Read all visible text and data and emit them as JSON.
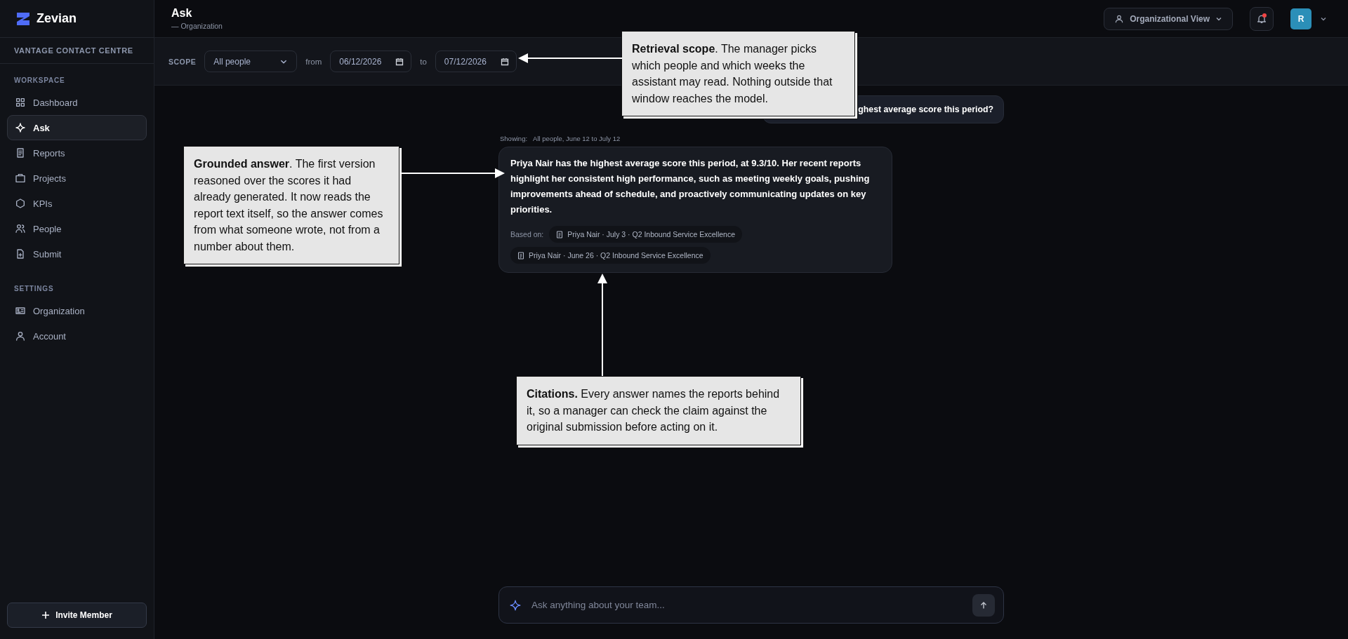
{
  "brand": {
    "name": "Zevian"
  },
  "sidebar": {
    "org": "VANTAGE CONTACT CENTRE",
    "sections": [
      {
        "title": "WORKSPACE",
        "items": [
          {
            "label": "Dashboard",
            "selected": false
          },
          {
            "label": "Ask",
            "selected": true
          },
          {
            "label": "Reports",
            "selected": false
          },
          {
            "label": "Projects",
            "selected": false
          },
          {
            "label": "KPIs",
            "selected": false
          },
          {
            "label": "People",
            "selected": false
          },
          {
            "label": "Submit",
            "selected": false
          }
        ]
      },
      {
        "title": "SETTINGS",
        "items": [
          {
            "label": "Organization",
            "selected": false
          },
          {
            "label": "Account",
            "selected": false
          }
        ]
      }
    ],
    "invite_button": "Invite Member"
  },
  "header": {
    "title": "Ask",
    "subtitle": "— Organization",
    "view_button": "Organizational View",
    "unread": true,
    "avatar": "R"
  },
  "scope": {
    "label": "SCOPE",
    "people": "All people",
    "from_label": "from",
    "from": "06/12/2026",
    "to_label": "to",
    "to": "07/12/2026"
  },
  "chat": {
    "question": "ghest average score this period?",
    "showing_label": "Showing:",
    "showing": "All people, June 12 to July 12",
    "answer": "Priya Nair has the highest average score this period, at 9.3/10. Her recent reports highlight her consistent high performance, such as meeting weekly goals, pushing improvements ahead of schedule, and proactively communicating updates on key priorities.",
    "based_on_label": "Based on:",
    "citations": [
      "Priya Nair · July 3 · Q2 Inbound Service Excellence",
      "Priya Nair · June 26 · Q2 Inbound Service Excellence"
    ]
  },
  "composer": {
    "placeholder": "Ask anything about your team..."
  },
  "callouts": [
    {
      "text": "**Retrieval scope**. The manager picks which people and which weeks the assistant may read. Nothing outside that window reaches the model."
    },
    {
      "text": "**Grounded answer**. The first version reasoned over the scores it had already generated. It now reads the report text itself, so the answer comes from what someone wrote, not from a number about them."
    },
    {
      "text": "**Citations.** Every answer names the reports behind it, so a manager can check the claim against the original submission before acting on it."
    }
  ]
}
